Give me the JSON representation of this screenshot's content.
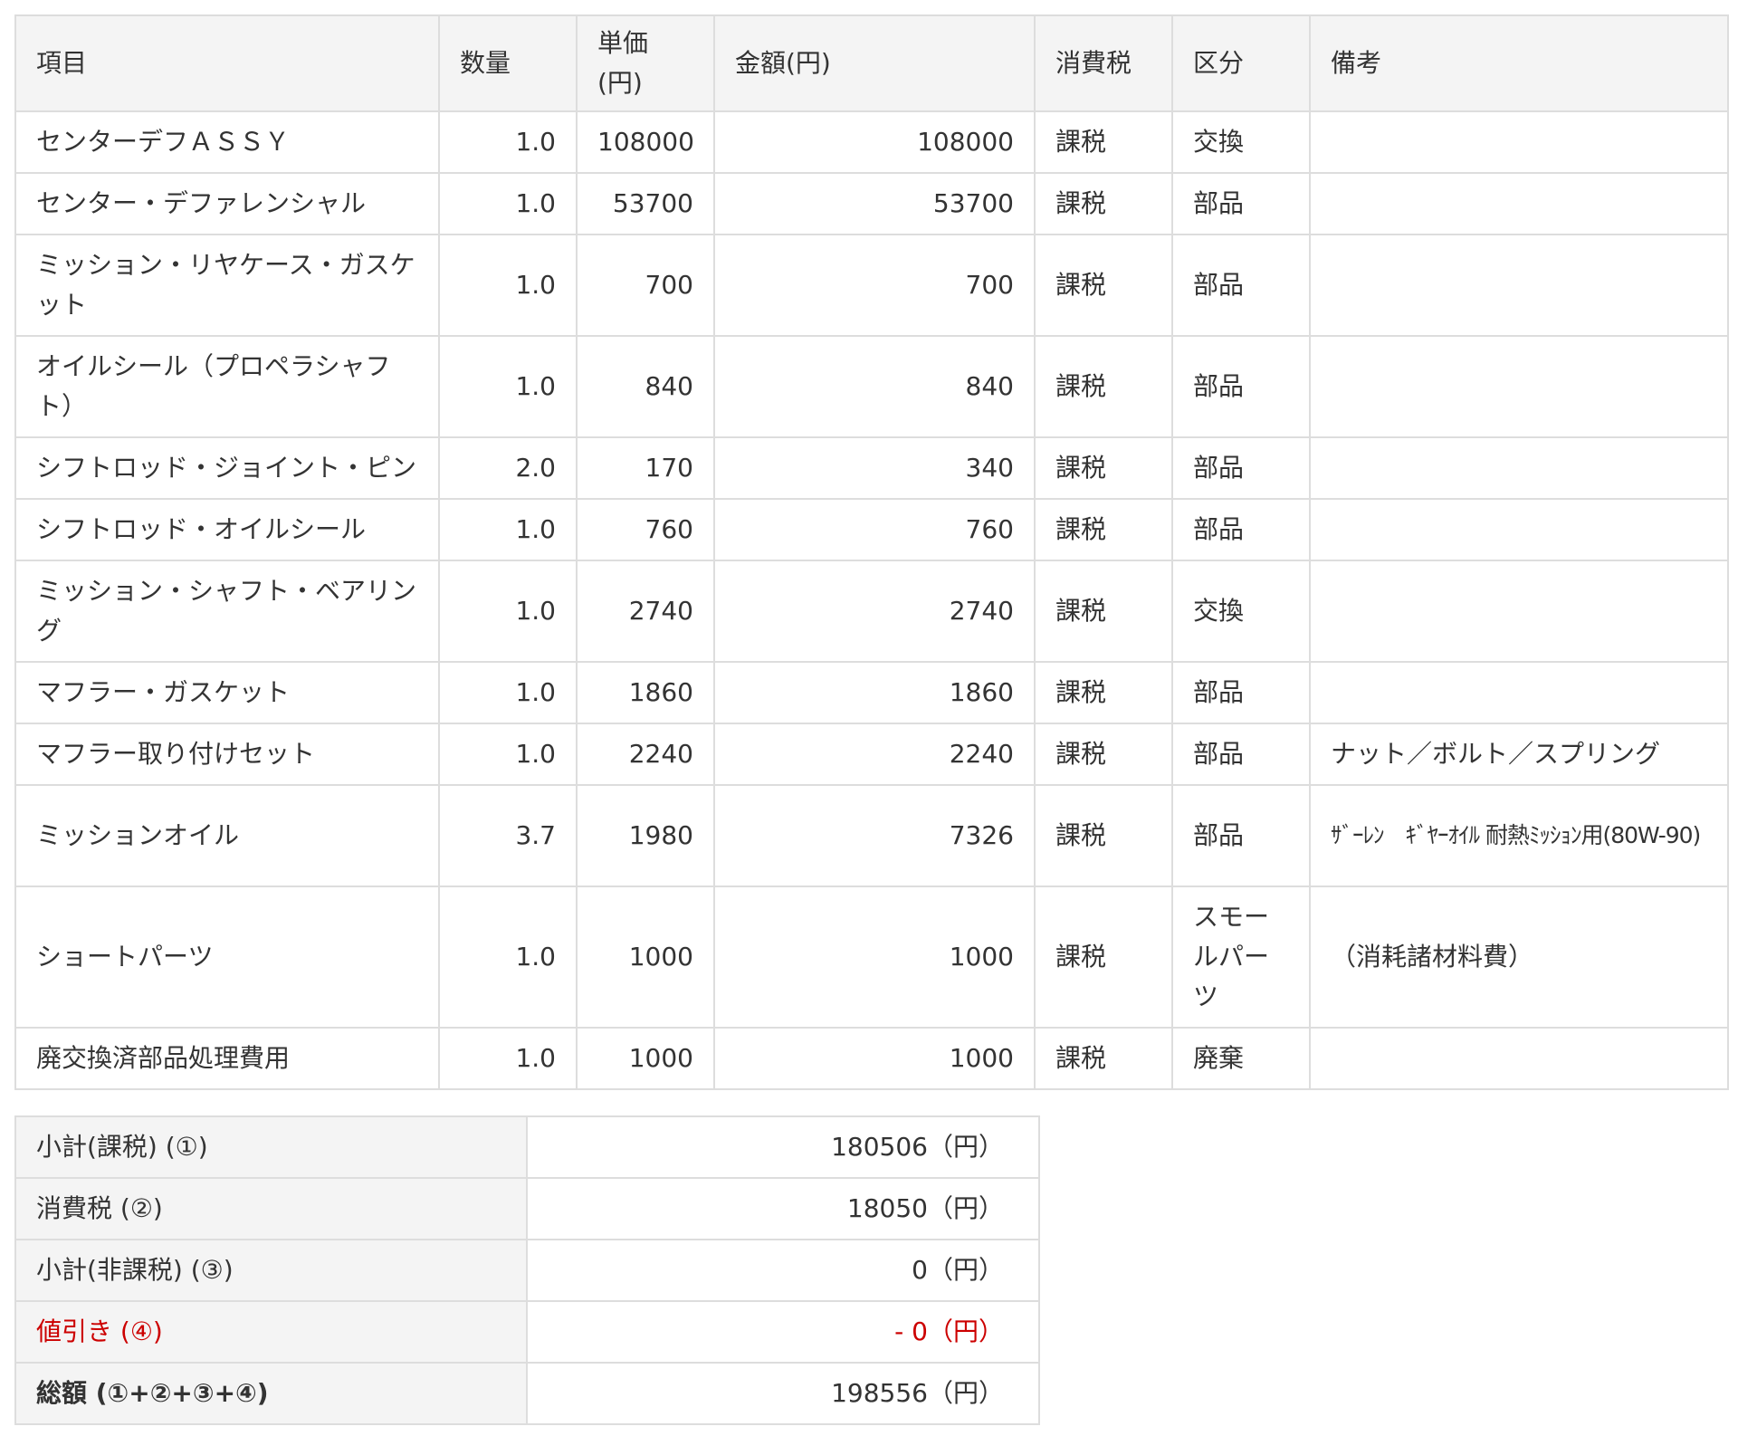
{
  "table": {
    "headers": {
      "item": "項目",
      "qty": "数量",
      "unit_price_1": "単価",
      "unit_price_2": "(円)",
      "amount": "金額(円)",
      "tax": "消費税",
      "category": "区分",
      "remarks": "備考"
    },
    "rows": [
      {
        "item": "センターデフＡＳＳＹ",
        "qty": "1.0",
        "unit_price": "108000",
        "amount": "108000",
        "tax": "課税",
        "category": "交換",
        "remarks": ""
      },
      {
        "item": "センター・デファレンシャル",
        "qty": "1.0",
        "unit_price": "53700",
        "amount": "53700",
        "tax": "課税",
        "category": "部品",
        "remarks": ""
      },
      {
        "item": "ミッション・リヤケース・ガスケット",
        "qty": "1.0",
        "unit_price": "700",
        "amount": "700",
        "tax": "課税",
        "category": "部品",
        "remarks": ""
      },
      {
        "item": "オイルシール（プロペラシャフト）",
        "qty": "1.0",
        "unit_price": "840",
        "amount": "840",
        "tax": "課税",
        "category": "部品",
        "remarks": ""
      },
      {
        "item": "シフトロッド・ジョイント・ピン",
        "qty": "2.0",
        "unit_price": "170",
        "amount": "340",
        "tax": "課税",
        "category": "部品",
        "remarks": ""
      },
      {
        "item": "シフトロッド・オイルシール",
        "qty": "1.0",
        "unit_price": "760",
        "amount": "760",
        "tax": "課税",
        "category": "部品",
        "remarks": ""
      },
      {
        "item": "ミッション・シャフト・ベアリング",
        "qty": "1.0",
        "unit_price": "2740",
        "amount": "2740",
        "tax": "課税",
        "category": "交換",
        "remarks": ""
      },
      {
        "item": "マフラー・ガスケット",
        "qty": "1.0",
        "unit_price": "1860",
        "amount": "1860",
        "tax": "課税",
        "category": "部品",
        "remarks": ""
      },
      {
        "item": "マフラー取り付けセット",
        "qty": "1.0",
        "unit_price": "2240",
        "amount": "2240",
        "tax": "課税",
        "category": "部品",
        "remarks": "ナット／ボルト／スプリング"
      },
      {
        "item": "ミッションオイル",
        "qty": "3.7",
        "unit_price": "1980",
        "amount": "7326",
        "tax": "課税",
        "category": "部品",
        "remarks": "ｻﾞｰﾚﾝ　ｷﾞﾔｰｵｲﾙ 耐熱ﾐｯｼｮﾝ用(80W-90)"
      },
      {
        "item": "ショートパーツ",
        "qty": "1.0",
        "unit_price": "1000",
        "amount": "1000",
        "tax": "課税",
        "category": "スモールパーツ",
        "remarks": "（消耗諸材料費）"
      },
      {
        "item": "廃交換済部品処理費用",
        "qty": "1.0",
        "unit_price": "1000",
        "amount": "1000",
        "tax": "課税",
        "category": "廃棄",
        "remarks": ""
      }
    ]
  },
  "totals": [
    {
      "label": "小計(課税) (①)",
      "value": "180506（円）"
    },
    {
      "label": "消費税 (②)",
      "value": "18050（円）"
    },
    {
      "label": "小計(非課税) (③)",
      "value": "0（円）"
    },
    {
      "label": "値引き (④)",
      "value": "- 0（円）"
    },
    {
      "label": "総額 (①+②+③+④)",
      "value": "198556（円）"
    }
  ]
}
